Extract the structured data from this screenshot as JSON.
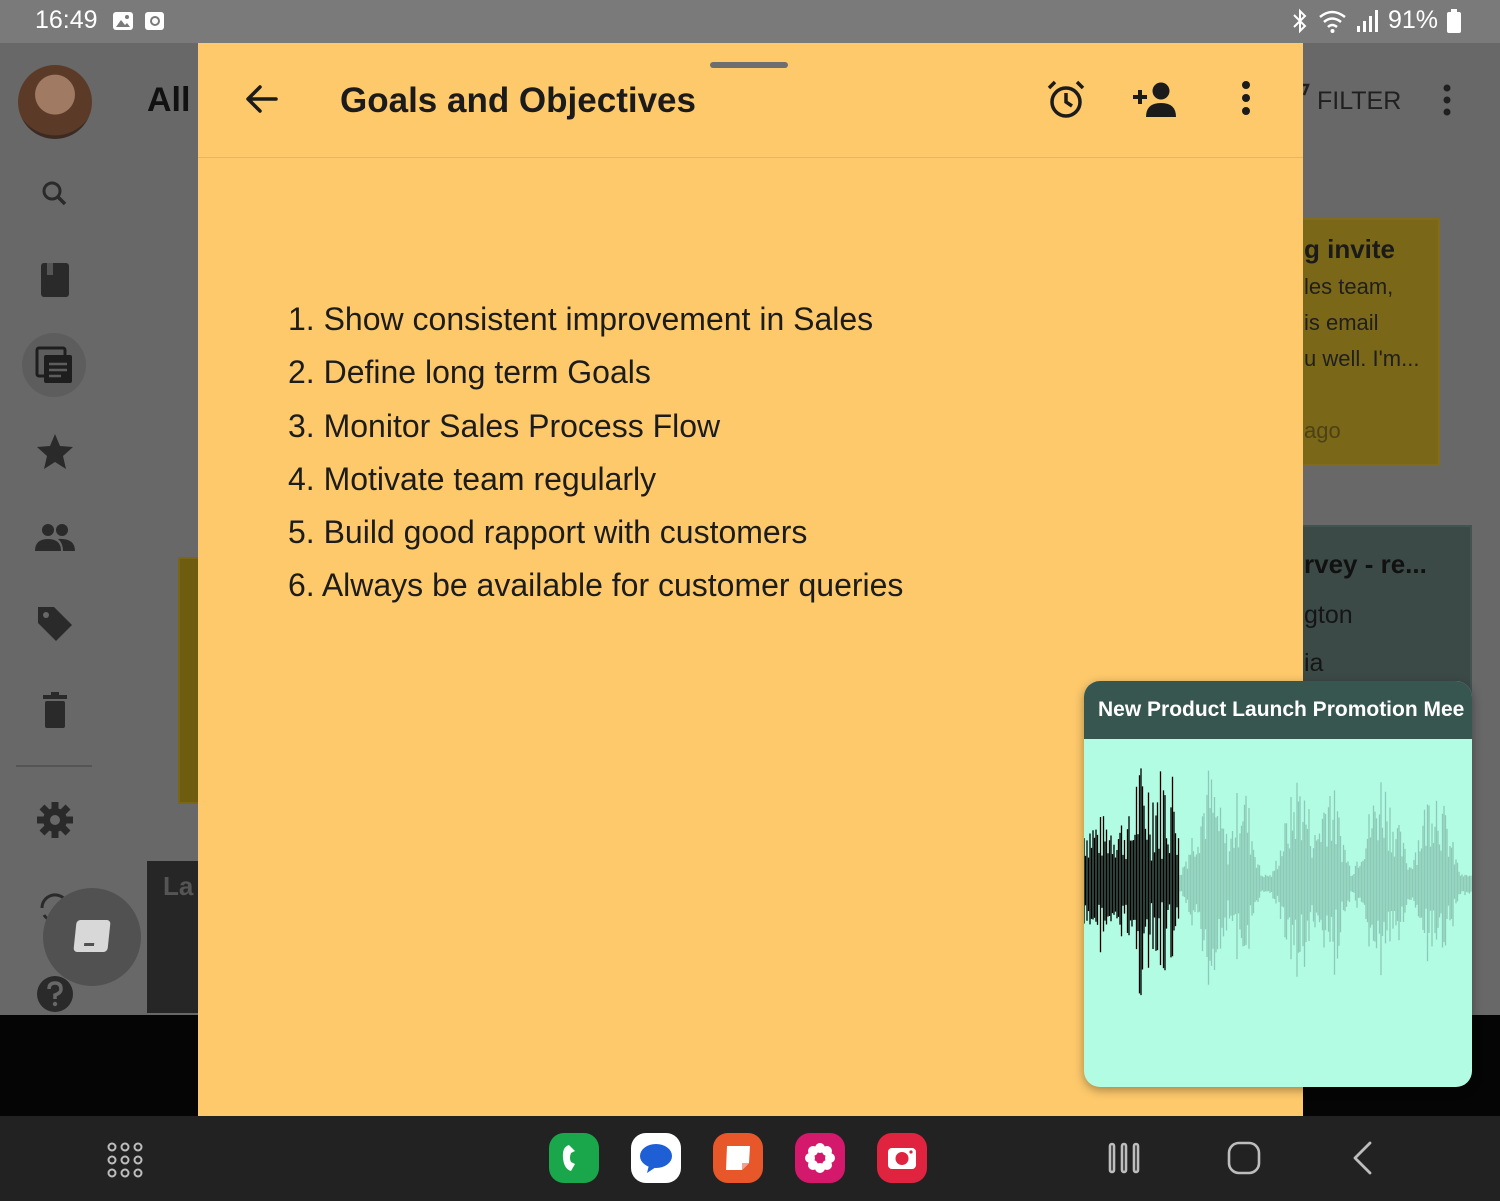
{
  "status_bar": {
    "time": "16:49",
    "battery": "91%",
    "icons": [
      "gallery-icon",
      "screen-record-icon",
      "bluetooth-icon",
      "wifi-icon",
      "signal-icon",
      "battery-icon"
    ]
  },
  "background_app": {
    "title": "All",
    "filter_label": "FILTER",
    "rail_icons": [
      "search-icon",
      "notebook-icon",
      "all-notes-icon",
      "star-icon",
      "people-icon",
      "tag-icon",
      "trash-icon",
      "settings-icon",
      "sync-icon",
      "help-icon"
    ],
    "card_invite": {
      "title": "g invite",
      "lines": [
        "les team,",
        "is email",
        "u well. I'm..."
      ],
      "time": "ago"
    },
    "card_survey": {
      "title": "rvey - re...",
      "lines": [
        "gton",
        "ia"
      ]
    },
    "dark_card_text": "La"
  },
  "note": {
    "title": "Goals and Objectives",
    "items": [
      "1. Show consistent improvement in Sales",
      "2. Define long term Goals",
      "3. Monitor Sales Process Flow",
      "4. Motivate team regularly",
      "5. Build good rapport with customers",
      "6. Always be available for customer queries"
    ],
    "icons": [
      "back-arrow-icon",
      "alarm-icon",
      "add-person-icon",
      "more-vert-icon"
    ]
  },
  "audio_popup": {
    "title": "New Product Launch Promotion Mee",
    "played_color": "#000000",
    "unplayed_color": "#8cc9b6",
    "background_color": "#b2fce4",
    "header_color": "#385650"
  },
  "nav_bar": {
    "apps": [
      {
        "name": "phone-app",
        "color": "#1aa64a"
      },
      {
        "name": "messages-app",
        "color": "#ffffff"
      },
      {
        "name": "notes-app",
        "color": "#e8572a"
      },
      {
        "name": "gallery-app",
        "color": "#d4186b"
      },
      {
        "name": "camera-app",
        "color": "#e0243f"
      }
    ],
    "buttons": [
      "app-drawer-icon",
      "recents-icon",
      "home-icon",
      "back-icon"
    ]
  },
  "colors": {
    "note_background": "#fdc96b",
    "dim_overlay": "#686868",
    "status_bar": "#7a7a7a"
  }
}
